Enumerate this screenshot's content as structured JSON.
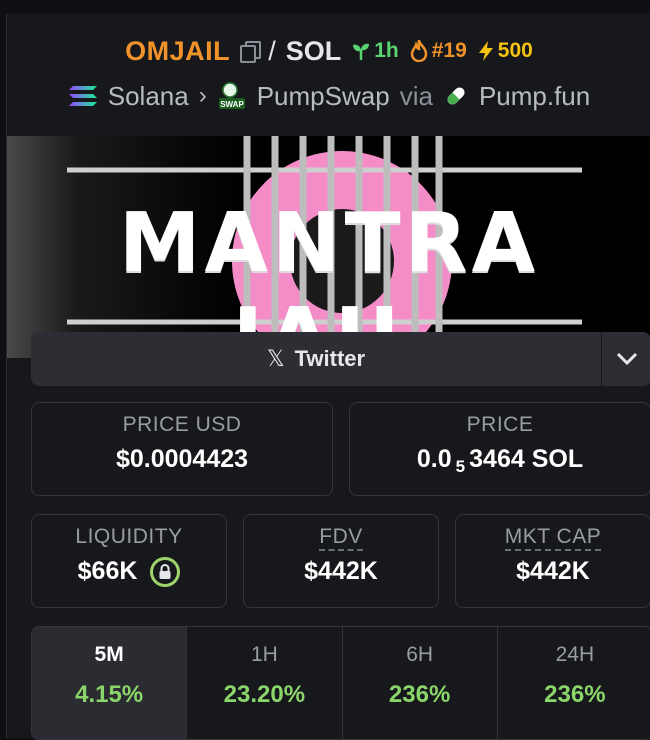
{
  "header": {
    "base_symbol": "OMJAIL",
    "separator": "/",
    "quote_symbol": "SOL",
    "age": "1h",
    "rank": "#19",
    "boosts": "500",
    "chain": "Solana",
    "dex": "PumpSwap",
    "via_label": "via",
    "launchpad": "Pump.fun",
    "swap_badge": "SWAP",
    "icons": {
      "copy": "copy-icon",
      "age": "seedling-icon",
      "rank": "fire-icon",
      "boosts": "lightning-icon",
      "chain": "solana-icon",
      "breadcrumb": "chevron-right-icon",
      "dex": "pumpswap-icon",
      "launchpad": "pill-icon"
    },
    "colors": {
      "symbol": "#f0932b",
      "age": "#5ad371",
      "rank": "#f0932b",
      "boosts": "#f5c211"
    }
  },
  "banner": {
    "text": "MANTRA JAIL"
  },
  "socials": {
    "twitter_label": "Twitter",
    "twitter_icon": "x-logo-icon",
    "expand_icon": "chevron-down-icon"
  },
  "stats": {
    "price_usd_label": "PRICE USD",
    "price_usd_value": "$0.0004423",
    "price_label": "PRICE",
    "price_prefix": "0.0",
    "price_zeros_subscript": "5",
    "price_suffix": "3464 SOL",
    "liquidity_label": "LIQUIDITY",
    "liquidity_value": "$66K",
    "liquidity_icon": "lock-icon",
    "fdv_label": "FDV",
    "fdv_value": "$442K",
    "mktcap_label": "MKT CAP",
    "mktcap_value": "$442K"
  },
  "timeframes": [
    {
      "label": "5M",
      "change": "4.15%",
      "active": true
    },
    {
      "label": "1H",
      "change": "23.20%",
      "active": false
    },
    {
      "label": "6H",
      "change": "236%",
      "active": false
    },
    {
      "label": "24H",
      "change": "236%",
      "active": false
    }
  ],
  "accent_colors": {
    "positive": "#8bd66a",
    "lock_ring": "#9fd46c"
  }
}
